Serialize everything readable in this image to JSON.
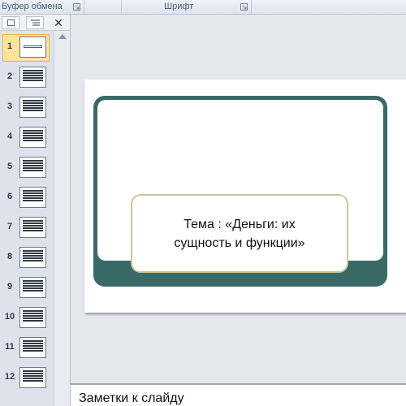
{
  "ribbon": {
    "groups": [
      {
        "label": "Буфер обмена"
      },
      {
        "label": "Шрифт"
      }
    ]
  },
  "panel": {
    "tabs": [
      "slides-tab",
      "outline-tab"
    ],
    "close_glyph": "✕"
  },
  "thumbnails": [
    {
      "number": "1",
      "selected": true
    },
    {
      "number": "2"
    },
    {
      "number": "3"
    },
    {
      "number": "4"
    },
    {
      "number": "5"
    },
    {
      "number": "6"
    },
    {
      "number": "7"
    },
    {
      "number": "8"
    },
    {
      "number": "9"
    },
    {
      "number": "10"
    },
    {
      "number": "11"
    },
    {
      "number": "12"
    }
  ],
  "slide": {
    "title_line1": "Тема  : «Деньги:  их",
    "title_line2": "сущность и функции»"
  },
  "notes": {
    "placeholder": "Заметки к слайду"
  },
  "colors": {
    "frame": "#3a6a67",
    "selection": "#fde49a",
    "title_border": "#c8c89a"
  }
}
